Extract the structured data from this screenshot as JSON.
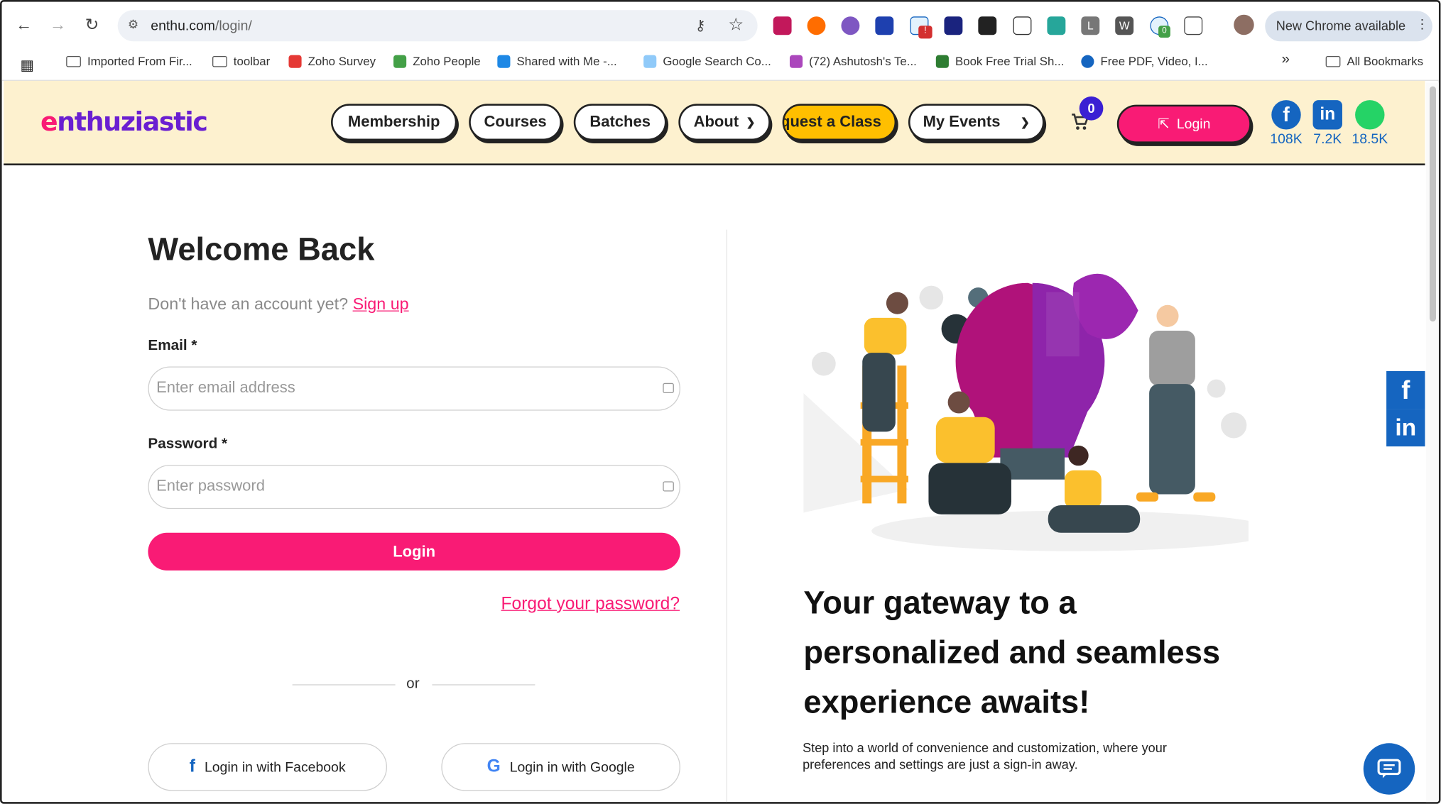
{
  "browser": {
    "url_host": "enthu.com",
    "url_path": "/login/",
    "new_chrome_label": "New Chrome available",
    "bookmarks": [
      "Imported From Fir...",
      "toolbar",
      "Zoho Survey",
      "Zoho People",
      "Shared with Me -...",
      "Google Search Co...",
      "(72) Ashutosh's Te...",
      "Book Free Trial Sh...",
      "Free PDF, Video, I..."
    ],
    "more_bookmarks": "»",
    "all_bookmarks": "All Bookmarks",
    "ext_badge_red": "!",
    "ext_badge_green": "0"
  },
  "site": {
    "logo_e": "e",
    "logo_rest": "nthuziastic",
    "nav": {
      "membership": "Membership",
      "courses": "Courses",
      "batches": "Batches",
      "about": "About",
      "request_class": "quest a Class",
      "my_events": "My Events"
    },
    "cart_count": "0",
    "login_label": "Login",
    "social": {
      "facebook": "108K",
      "linkedin": "7.2K",
      "whatsapp": "18.5K"
    }
  },
  "form": {
    "title": "Welcome Back",
    "no_account": "Don't have an account yet?",
    "signup": "Sign up",
    "email_label": "Email *",
    "email_placeholder": "Enter email address",
    "password_label": "Password *",
    "password_placeholder": "Enter password",
    "submit": "Login",
    "forgot": "Forgot your password?",
    "or": "or",
    "facebook_btn": "Login in with Facebook",
    "google_btn": "Login in with Google"
  },
  "promo": {
    "headline": "Your gateway to a personalized and seamless experience awaits!",
    "body": "Step into a world of convenience and customization, where your preferences and settings are just a sign-in away."
  },
  "share": {
    "facebook": "f",
    "linkedin": "in"
  },
  "colors": {
    "brand_pink": "#f91b75",
    "header_bg": "#fdf1cf",
    "request_yellow": "#ffbf00",
    "link_blue": "#1565c0"
  }
}
